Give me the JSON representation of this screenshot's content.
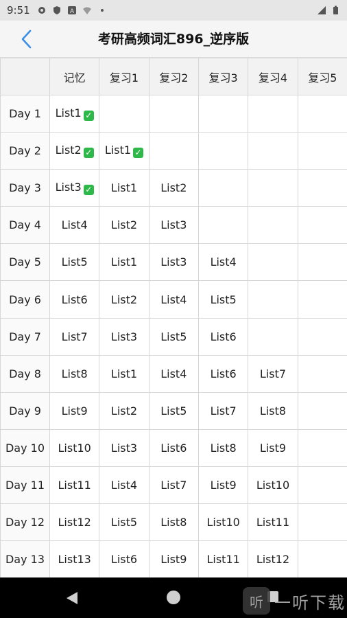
{
  "status_bar": {
    "time": "9:51",
    "icons": [
      "settings-icon",
      "shield-icon",
      "a-icon",
      "wifi-icon",
      "dot-icon",
      "signal-icon",
      "battery-icon"
    ]
  },
  "app_bar": {
    "back_icon": "chevron-left-icon",
    "title": "考研高频词汇896_逆序版",
    "accent_color": "#3a8ee6"
  },
  "table": {
    "headers": [
      "",
      "记忆",
      "复习1",
      "复习2",
      "复习3",
      "复习4",
      "复习5"
    ],
    "rows": [
      {
        "day": "Day 1",
        "cells": [
          {
            "text": "List1",
            "checked": true
          },
          {
            "text": ""
          },
          {
            "text": ""
          },
          {
            "text": ""
          },
          {
            "text": ""
          },
          {
            "text": ""
          }
        ]
      },
      {
        "day": "Day 2",
        "cells": [
          {
            "text": "List2",
            "checked": true
          },
          {
            "text": "List1",
            "checked": true
          },
          {
            "text": ""
          },
          {
            "text": ""
          },
          {
            "text": ""
          },
          {
            "text": ""
          }
        ]
      },
      {
        "day": "Day 3",
        "cells": [
          {
            "text": "List3",
            "checked": true
          },
          {
            "text": "List1"
          },
          {
            "text": "List2"
          },
          {
            "text": ""
          },
          {
            "text": ""
          },
          {
            "text": ""
          }
        ]
      },
      {
        "day": "Day 4",
        "cells": [
          {
            "text": "List4"
          },
          {
            "text": "List2"
          },
          {
            "text": "List3"
          },
          {
            "text": ""
          },
          {
            "text": ""
          },
          {
            "text": ""
          }
        ]
      },
      {
        "day": "Day 5",
        "cells": [
          {
            "text": "List5"
          },
          {
            "text": "List1"
          },
          {
            "text": "List3"
          },
          {
            "text": "List4"
          },
          {
            "text": ""
          },
          {
            "text": ""
          }
        ]
      },
      {
        "day": "Day 6",
        "cells": [
          {
            "text": "List6"
          },
          {
            "text": "List2"
          },
          {
            "text": "List4"
          },
          {
            "text": "List5"
          },
          {
            "text": ""
          },
          {
            "text": ""
          }
        ]
      },
      {
        "day": "Day 7",
        "cells": [
          {
            "text": "List7"
          },
          {
            "text": "List3"
          },
          {
            "text": "List5"
          },
          {
            "text": "List6"
          },
          {
            "text": ""
          },
          {
            "text": ""
          }
        ]
      },
      {
        "day": "Day 8",
        "cells": [
          {
            "text": "List8"
          },
          {
            "text": "List1"
          },
          {
            "text": "List4"
          },
          {
            "text": "List6"
          },
          {
            "text": "List7"
          },
          {
            "text": ""
          }
        ]
      },
      {
        "day": "Day 9",
        "cells": [
          {
            "text": "List9"
          },
          {
            "text": "List2"
          },
          {
            "text": "List5"
          },
          {
            "text": "List7"
          },
          {
            "text": "List8"
          },
          {
            "text": ""
          }
        ]
      },
      {
        "day": "Day 10",
        "cells": [
          {
            "text": "List10"
          },
          {
            "text": "List3"
          },
          {
            "text": "List6"
          },
          {
            "text": "List8"
          },
          {
            "text": "List9"
          },
          {
            "text": ""
          }
        ]
      },
      {
        "day": "Day 11",
        "cells": [
          {
            "text": "List11"
          },
          {
            "text": "List4"
          },
          {
            "text": "List7"
          },
          {
            "text": "List9"
          },
          {
            "text": "List10"
          },
          {
            "text": ""
          }
        ]
      },
      {
        "day": "Day 12",
        "cells": [
          {
            "text": "List12"
          },
          {
            "text": "List5"
          },
          {
            "text": "List8"
          },
          {
            "text": "List10"
          },
          {
            "text": "List11"
          },
          {
            "text": ""
          }
        ]
      },
      {
        "day": "Day 13",
        "cells": [
          {
            "text": "List13"
          },
          {
            "text": "List6"
          },
          {
            "text": "List9"
          },
          {
            "text": "List11"
          },
          {
            "text": "List12"
          },
          {
            "text": ""
          }
        ]
      }
    ],
    "check_color": "#2fb84a"
  },
  "nav_bar": {
    "icons": [
      "nav-back-icon",
      "nav-home-icon",
      "nav-recents-icon"
    ]
  },
  "watermark": {
    "logo_glyph": "听",
    "text": "一听下载"
  }
}
